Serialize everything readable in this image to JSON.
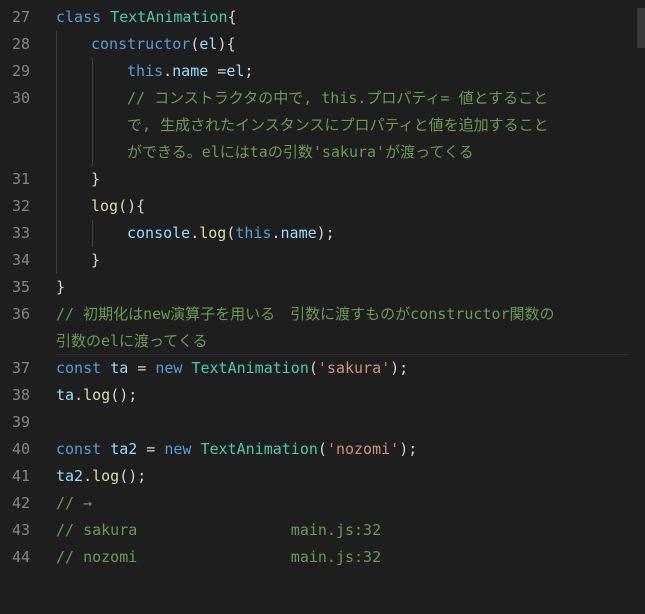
{
  "colors": {
    "background": "#1e1e1e",
    "keyword": "#569cd6",
    "class_name": "#4ec9b0",
    "function": "#dcdcaa",
    "variable": "#9cdcfe",
    "string": "#ce9178",
    "comment": "#6a9955",
    "line_number": "#858585"
  },
  "lines": [
    {
      "num": "27",
      "tokens": [
        "class",
        " ",
        "TextAnimation",
        "{"
      ]
    },
    {
      "num": "28",
      "tokens": [
        "constructor",
        "(",
        "el",
        "){"
      ]
    },
    {
      "num": "29",
      "tokens": [
        "this",
        ".",
        "name",
        " =",
        "el",
        ";"
      ]
    },
    {
      "num": "30",
      "tokens": [
        "// コンストラクタの中で, this.プロパティ= 値とすること"
      ]
    },
    {
      "num": "",
      "tokens": [
        "で, 生成されたインスタンスにプロパティと値を追加すること"
      ]
    },
    {
      "num": "",
      "tokens": [
        "ができる。elにはtaの引数'sakura'が渡ってくる"
      ]
    },
    {
      "num": "31",
      "tokens": [
        "}"
      ]
    },
    {
      "num": "32",
      "tokens": [
        "log",
        "(){"
      ]
    },
    {
      "num": "33",
      "tokens": [
        "console",
        ".",
        "log",
        "(",
        "this",
        ".",
        "name",
        ");"
      ]
    },
    {
      "num": "34",
      "tokens": [
        "}"
      ]
    },
    {
      "num": "35",
      "tokens": [
        "}"
      ]
    },
    {
      "num": "36",
      "tokens": [
        "// 初期化はnew演算子を用いる　引数に渡すものがconstructor関数の"
      ]
    },
    {
      "num": "",
      "tokens": [
        "引数のelに渡ってくる"
      ]
    },
    {
      "num": "37",
      "tokens": [
        "const",
        " ",
        "ta",
        " = ",
        "new",
        " ",
        "TextAnimation",
        "(",
        "'sakura'",
        ");"
      ]
    },
    {
      "num": "38",
      "tokens": [
        "ta",
        ".",
        "log",
        "();"
      ]
    },
    {
      "num": "39",
      "tokens": [
        ""
      ]
    },
    {
      "num": "40",
      "tokens": [
        "const",
        " ",
        "ta2",
        " = ",
        "new",
        " ",
        "TextAnimation",
        "(",
        "'nozomi'",
        ");"
      ]
    },
    {
      "num": "41",
      "tokens": [
        "ta2",
        ".",
        "log",
        "();"
      ]
    },
    {
      "num": "42",
      "tokens": [
        "// →"
      ]
    },
    {
      "num": "43",
      "tokens": [
        "// sakura                 main.js:32"
      ]
    },
    {
      "num": "44",
      "tokens": [
        "// nozomi                 main.js:32"
      ]
    }
  ]
}
